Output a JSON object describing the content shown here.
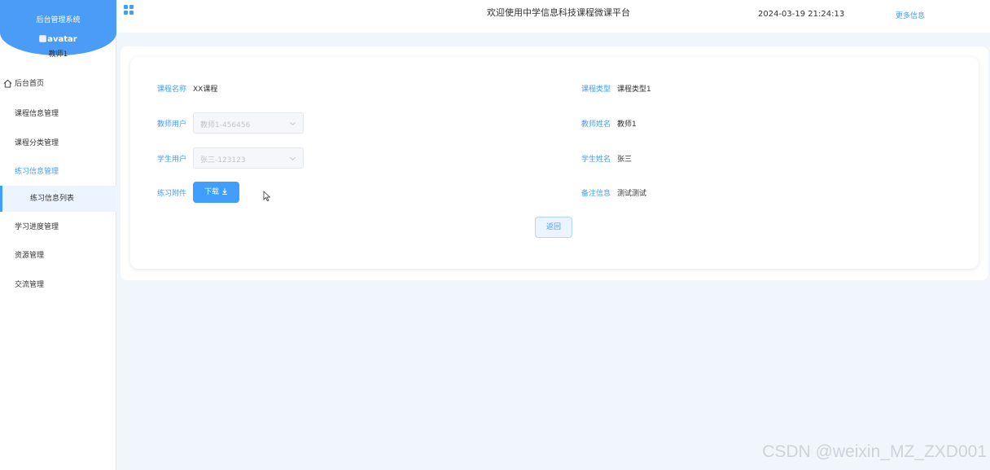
{
  "sidebar": {
    "system_title": "后台管理系统",
    "avatar_alt": "avatar",
    "user_name": "教师1",
    "menu": [
      {
        "label": "后台首页",
        "icon": "home-icon"
      },
      {
        "label": "课程信息管理"
      },
      {
        "label": "课程分类管理"
      },
      {
        "label": "练习信息管理"
      },
      {
        "label": "练习信息列表"
      },
      {
        "label": "学习进度管理"
      },
      {
        "label": "资源管理"
      },
      {
        "label": "交流管理"
      }
    ]
  },
  "header": {
    "menu_icon": "grid-icon",
    "welcome": "欢迎使用中学信息科技课程微课平台",
    "datetime": "2024-03-19 21:24:13",
    "more_info": "更多信息"
  },
  "form": {
    "course_name_label": "课程名称",
    "course_name_value": "XX课程",
    "course_type_label": "课程类型",
    "course_type_value": "课程类型1",
    "teacher_user_label": "教师用户",
    "teacher_user_value": "教师1-456456",
    "teacher_name_label": "教师姓名",
    "teacher_name_value": "教师1",
    "student_user_label": "学生用户",
    "student_user_value": "张三-123123",
    "student_name_label": "学生姓名",
    "student_name_value": "张三",
    "attachment_label": "练习附件",
    "download_label": "下载",
    "remark_label": "备注信息",
    "remark_value": "测试测试",
    "back_label": "返回"
  },
  "watermark": "CSDN @weixin_MZ_ZXD001",
  "colors": {
    "accent": "#409eff",
    "sidebar_header": "#4a9cf6",
    "main_bg": "#f1f6fd"
  }
}
